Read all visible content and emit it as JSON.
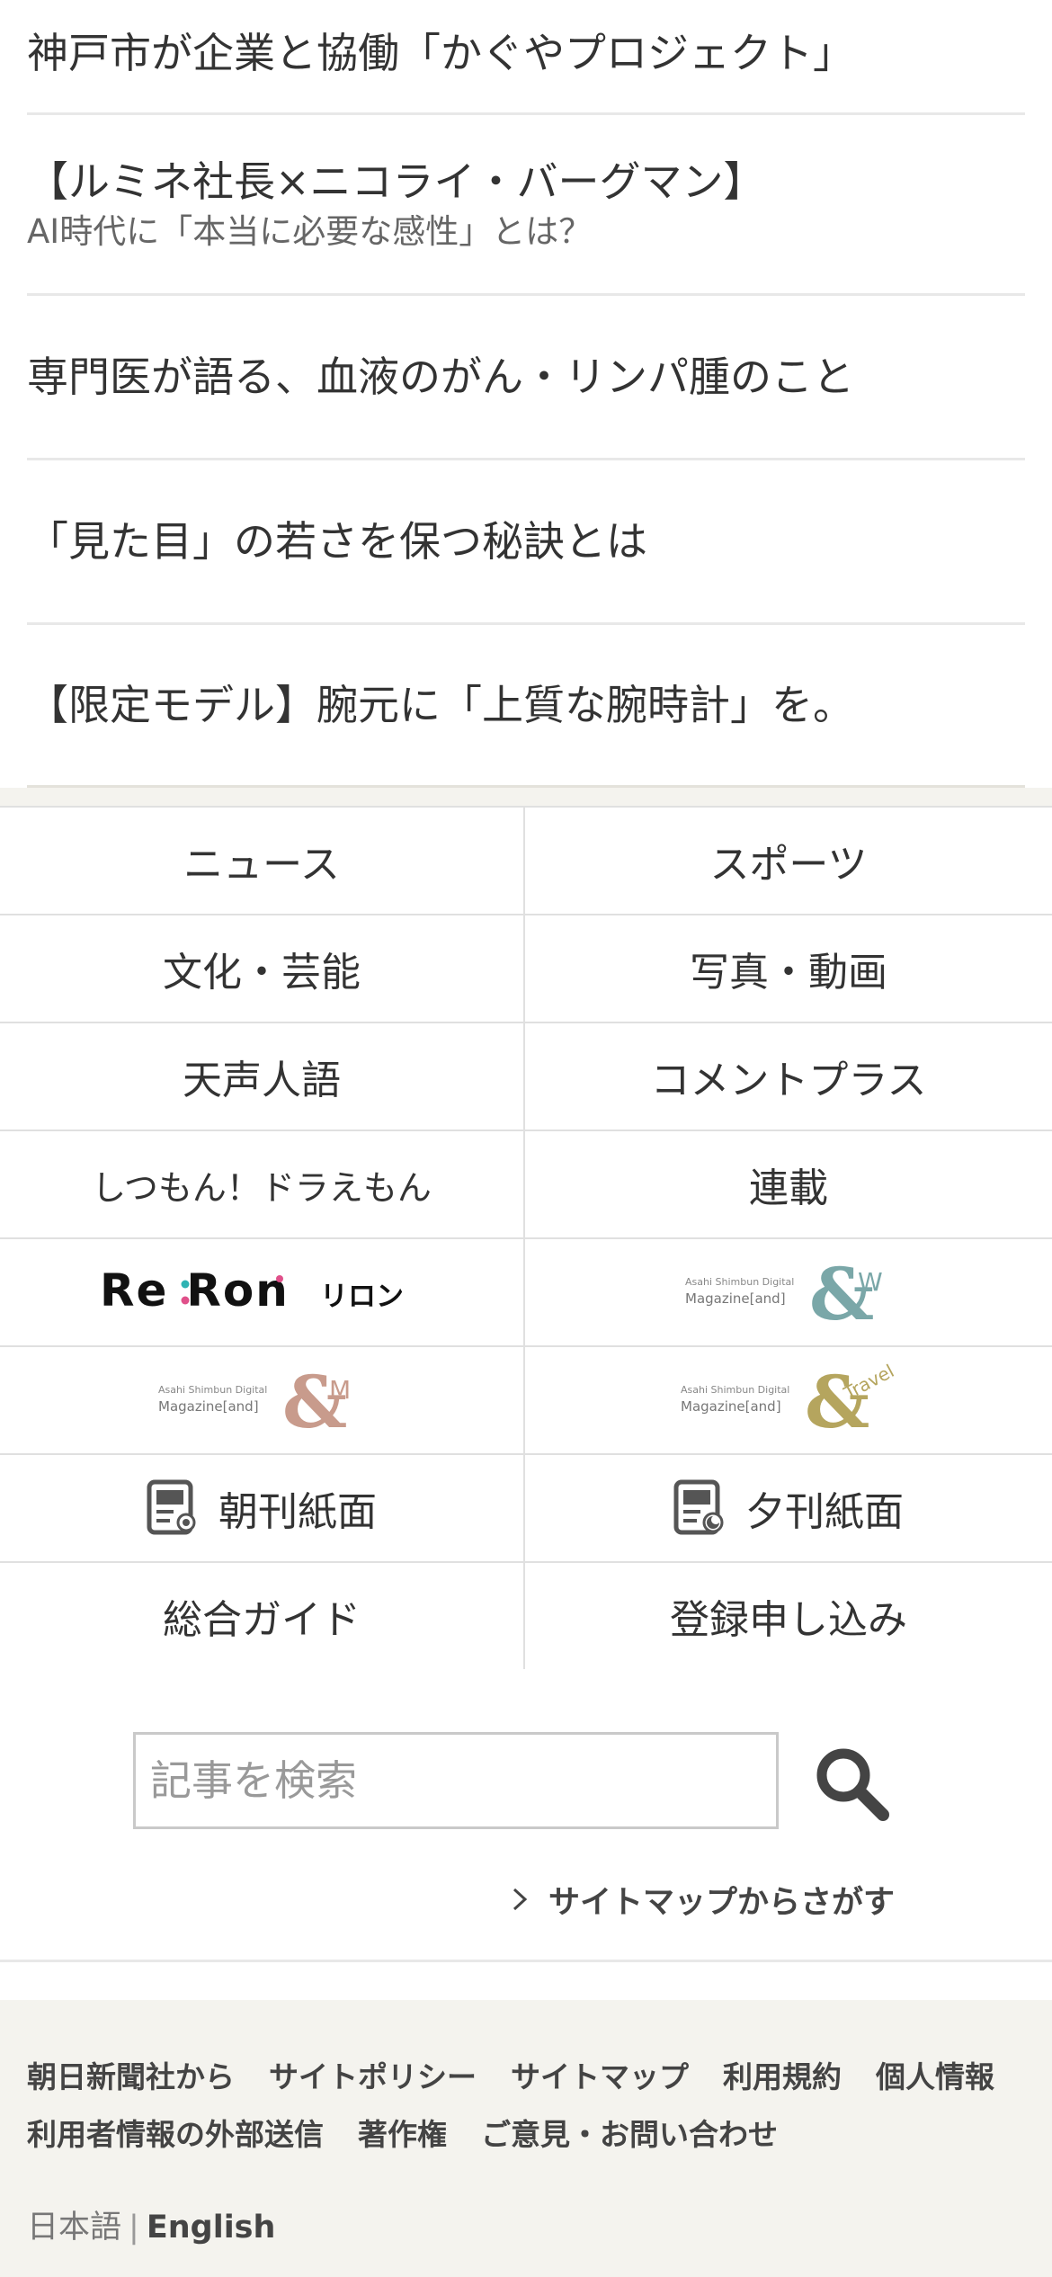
{
  "promo": {
    "items": [
      {
        "title": "神戸市が企業と協働「かぐやプロジェクト」"
      },
      {
        "title": "【ルミネ社長×ニコライ・バーグマン】",
        "subtitle": "AI時代に「本当に必要な感性」とは？"
      },
      {
        "title": "専門医が語る、血液のがん・リンパ腫のこと"
      },
      {
        "title": "「見た目」の若さを保つ秘訣とは"
      },
      {
        "title": "【限定モデル】腕元に「上質な腕時計」を。"
      }
    ]
  },
  "nav": {
    "news": "ニュース",
    "sports": "スポーツ",
    "culture": "文化・芸能",
    "photo_video": "写真・動画",
    "tenseijingo": "天声人語",
    "comment_plus": "コメントプラス",
    "shitsumon": "しつもん！ドラえもん",
    "rensai": "連載",
    "reron_logo": {
      "main": "Re:Ron",
      "kana": "リロン"
    },
    "and_w_logo": {
      "line1": "Asahi Shimbun Digital",
      "line2": "Magazine[and]",
      "suffix": "W",
      "color": "#7aa7a8"
    },
    "and_m_logo": {
      "line1": "Asahi Shimbun Digital",
      "line2": "Magazine[and]",
      "suffix": "M",
      "color": "#c89b8c"
    },
    "and_travel_logo": {
      "line1": "Asahi Shimbun Digital",
      "line2": "Magazine[and]",
      "suffix": "Travel",
      "color": "#b5a55e"
    },
    "morning_paper": "朝刊紙面",
    "evening_paper": "夕刊紙面",
    "guide": "総合ガイド",
    "register": "登録申し込み"
  },
  "search": {
    "placeholder": "記事を検索",
    "sitemap_link": "サイトマップからさがす"
  },
  "footer": {
    "row1": [
      "朝日新聞社から",
      "サイトポリシー",
      "サイトマップ",
      "利用規約",
      "個人情報"
    ],
    "row2": [
      "利用者情報の外部送信",
      "著作権",
      "ご意見・お問い合わせ"
    ],
    "lang_ja": "日本語",
    "lang_sep": "|",
    "lang_en": "English"
  },
  "colors": {
    "footer_bg": "#f4f3ee",
    "text": "#333333",
    "reron_dot_teal": "#2fb3b3",
    "reron_dot_pink": "#e0508a"
  }
}
